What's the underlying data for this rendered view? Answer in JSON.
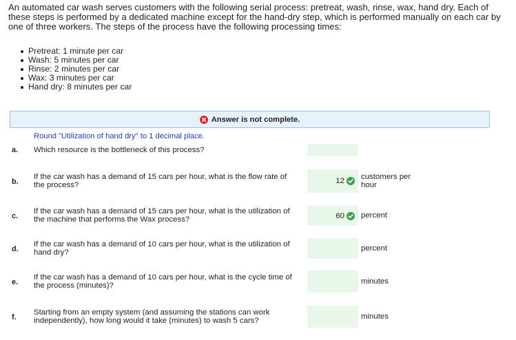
{
  "intro": "An automated car wash serves customers with the following serial process: pretreat, wash, rinse, wax, hand dry. Each of these steps is performed by a dedicated machine except for the hand-dry step, which is performed manually on each car by one of three workers. The steps of the process have the following processing times:",
  "steps": [
    "Pretreat: 1 minute per car",
    "Wash: 5 minutes per car",
    "Rinse: 2 minutes per car",
    "Wax: 3 minutes per car",
    "Hand dry: 8 minutes per car"
  ],
  "banner": {
    "text": "Answer is not complete.",
    "icon": "x-circle-icon",
    "color": "#d9262c"
  },
  "round_note": "Round \"Utilization of hand dry\" to 1 decimal place.",
  "colors": {
    "answer_bg": "#e9f7ea",
    "banner_bg": "#e6f1fb",
    "check": "#3c9f4a",
    "note": "#2338b8"
  },
  "questions": [
    {
      "letter": "a.",
      "text": "Which resource is the bottleneck of this process?",
      "answer": "",
      "correct": false,
      "unit": ""
    },
    {
      "letter": "b.",
      "text": "If the car wash has a demand of 15 cars per hour, what is the flow rate of the process?",
      "answer": "12",
      "correct": true,
      "unit": "customers per hour"
    },
    {
      "letter": "c.",
      "text": "If the car wash has a demand of 15 cars per hour, what is the utilization of the machine that performs the Wax process?",
      "answer": "60",
      "correct": true,
      "unit": "percent"
    },
    {
      "letter": "d.",
      "text": "If the car wash has a demand of 10 cars per hour, what is the utilization of hand dry?",
      "answer": "",
      "correct": false,
      "unit": "percent"
    },
    {
      "letter": "e.",
      "text": "If the car wash has a demand of 10 cars per hour, what is the cycle time of the process (minutes)?",
      "answer": "",
      "correct": false,
      "unit": "minutes"
    },
    {
      "letter": "f.",
      "text": "Starting from an empty system (and assuming the stations can work independently), how long would it take (minutes) to wash 5 cars?",
      "answer": "",
      "correct": false,
      "unit": "minutes"
    }
  ]
}
